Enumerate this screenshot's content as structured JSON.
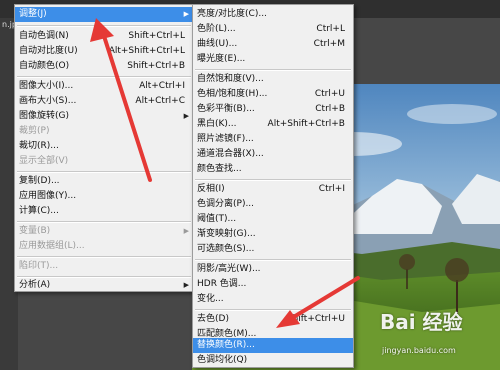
{
  "document": {
    "tab_label": "n.jp"
  },
  "main_menu": {
    "items": [
      {
        "label": "调整(J)",
        "shortcut": "",
        "submenu": true,
        "highlight": true,
        "disabled": false
      },
      {
        "label": "自动色调(N)",
        "shortcut": "Shift+Ctrl+L",
        "submenu": false,
        "highlight": false,
        "disabled": false
      },
      {
        "label": "自动对比度(U)",
        "shortcut": "Alt+Shift+Ctrl+L",
        "submenu": false,
        "highlight": false,
        "disabled": false
      },
      {
        "label": "自动颜色(O)",
        "shortcut": "Shift+Ctrl+B",
        "submenu": false,
        "highlight": false,
        "disabled": false
      },
      {
        "label": "图像大小(I)...",
        "shortcut": "Alt+Ctrl+I",
        "submenu": false,
        "highlight": false,
        "disabled": false
      },
      {
        "label": "画布大小(S)...",
        "shortcut": "Alt+Ctrl+C",
        "submenu": false,
        "highlight": false,
        "disabled": false
      },
      {
        "label": "图像旋转(G)",
        "shortcut": "",
        "submenu": true,
        "highlight": false,
        "disabled": false
      },
      {
        "label": "裁剪(P)",
        "shortcut": "",
        "submenu": false,
        "highlight": false,
        "disabled": true
      },
      {
        "label": "裁切(R)...",
        "shortcut": "",
        "submenu": false,
        "highlight": false,
        "disabled": false
      },
      {
        "label": "显示全部(V)",
        "shortcut": "",
        "submenu": false,
        "highlight": false,
        "disabled": true
      },
      {
        "label": "复制(D)...",
        "shortcut": "",
        "submenu": false,
        "highlight": false,
        "disabled": false
      },
      {
        "label": "应用图像(Y)...",
        "shortcut": "",
        "submenu": false,
        "highlight": false,
        "disabled": false
      },
      {
        "label": "计算(C)...",
        "shortcut": "",
        "submenu": false,
        "highlight": false,
        "disabled": false
      },
      {
        "label": "变量(B)",
        "shortcut": "",
        "submenu": true,
        "highlight": false,
        "disabled": true
      },
      {
        "label": "应用数据组(L)...",
        "shortcut": "",
        "submenu": false,
        "highlight": false,
        "disabled": true
      },
      {
        "label": "陷印(T)...",
        "shortcut": "",
        "submenu": false,
        "highlight": false,
        "disabled": true
      },
      {
        "label": "分析(A)",
        "shortcut": "",
        "submenu": true,
        "highlight": false,
        "disabled": false
      }
    ]
  },
  "adjust_submenu": {
    "items": [
      {
        "label": "亮度/对比度(C)...",
        "shortcut": "",
        "highlight": false
      },
      {
        "label": "色阶(L)...",
        "shortcut": "Ctrl+L",
        "highlight": false
      },
      {
        "label": "曲线(U)...",
        "shortcut": "Ctrl+M",
        "highlight": false
      },
      {
        "label": "曝光度(E)...",
        "shortcut": "",
        "highlight": false
      },
      {
        "label": "自然饱和度(V)...",
        "shortcut": "",
        "highlight": false
      },
      {
        "label": "色相/饱和度(H)...",
        "shortcut": "Ctrl+U",
        "highlight": false
      },
      {
        "label": "色彩平衡(B)...",
        "shortcut": "Ctrl+B",
        "highlight": false
      },
      {
        "label": "黑白(K)...",
        "shortcut": "Alt+Shift+Ctrl+B",
        "highlight": false
      },
      {
        "label": "照片滤镜(F)...",
        "shortcut": "",
        "highlight": false
      },
      {
        "label": "通道混合器(X)...",
        "shortcut": "",
        "highlight": false
      },
      {
        "label": "颜色查找...",
        "shortcut": "",
        "highlight": false
      },
      {
        "label": "反相(I)",
        "shortcut": "Ctrl+I",
        "highlight": false
      },
      {
        "label": "色调分离(P)...",
        "shortcut": "",
        "highlight": false
      },
      {
        "label": "阈值(T)...",
        "shortcut": "",
        "highlight": false
      },
      {
        "label": "渐变映射(G)...",
        "shortcut": "",
        "highlight": false
      },
      {
        "label": "可选颜色(S)...",
        "shortcut": "",
        "highlight": false
      },
      {
        "label": "阴影/高光(W)...",
        "shortcut": "",
        "highlight": false
      },
      {
        "label": "HDR 色调...",
        "shortcut": "",
        "highlight": false
      },
      {
        "label": "变化...",
        "shortcut": "",
        "highlight": false
      },
      {
        "label": "去色(D)",
        "shortcut": "Shift+Ctrl+U",
        "highlight": false
      },
      {
        "label": "匹配颜色(M)...",
        "shortcut": "",
        "highlight": false
      },
      {
        "label": "替换颜色(R)...",
        "shortcut": "",
        "highlight": true
      },
      {
        "label": "色调均化(Q)",
        "shortcut": "",
        "highlight": false
      }
    ]
  },
  "watermark": {
    "brand": "Bai 经验",
    "url": "jingyan.baidu.com"
  },
  "colors": {
    "highlight": "#3d8ee8",
    "arrow": "#e53935"
  }
}
